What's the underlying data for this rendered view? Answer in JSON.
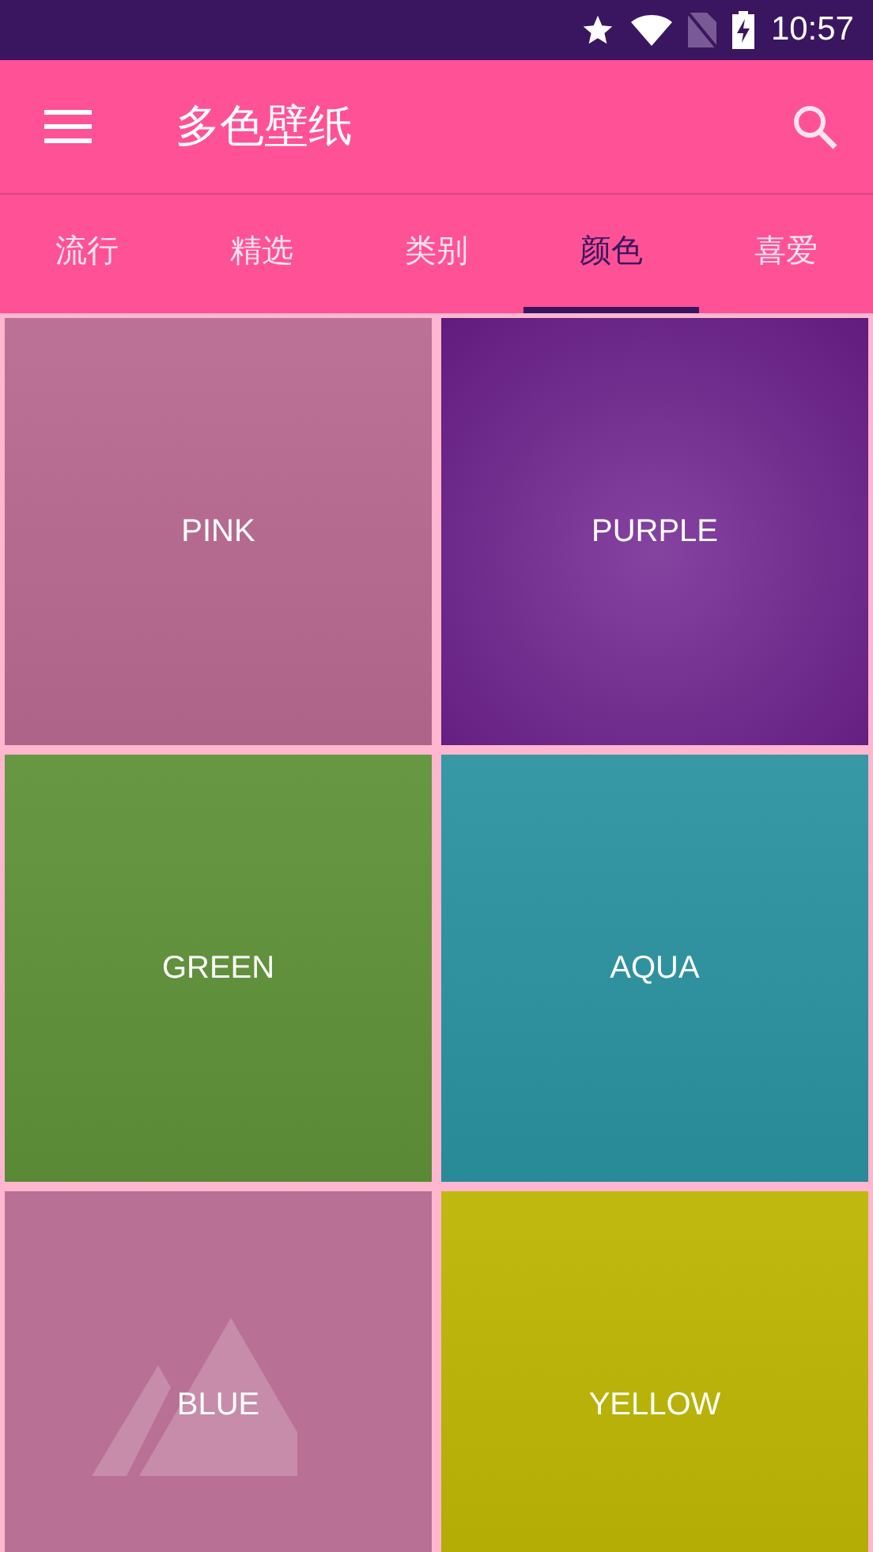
{
  "status_bar": {
    "time": "10:57"
  },
  "app_bar": {
    "title": "多色壁纸"
  },
  "tabs": [
    {
      "label": "流行",
      "selected": false
    },
    {
      "label": "精选",
      "selected": false
    },
    {
      "label": "类别",
      "selected": false
    },
    {
      "label": "颜色",
      "selected": true
    },
    {
      "label": "喜爱",
      "selected": false
    }
  ],
  "tiles": [
    {
      "label": "PINK",
      "kind": "gradient",
      "color": "#b86a90"
    },
    {
      "label": "PURPLE",
      "kind": "radial",
      "color": "#6e1f8e"
    },
    {
      "label": "GREEN",
      "kind": "gradient",
      "color": "#5f9238"
    },
    {
      "label": "AQUA",
      "kind": "gradient",
      "color": "#2b93a0"
    },
    {
      "label": "BLUE",
      "kind": "placeholder",
      "color": "#b87095"
    },
    {
      "label": "YELLOW",
      "kind": "gradient",
      "color": "#bcb503"
    }
  ]
}
